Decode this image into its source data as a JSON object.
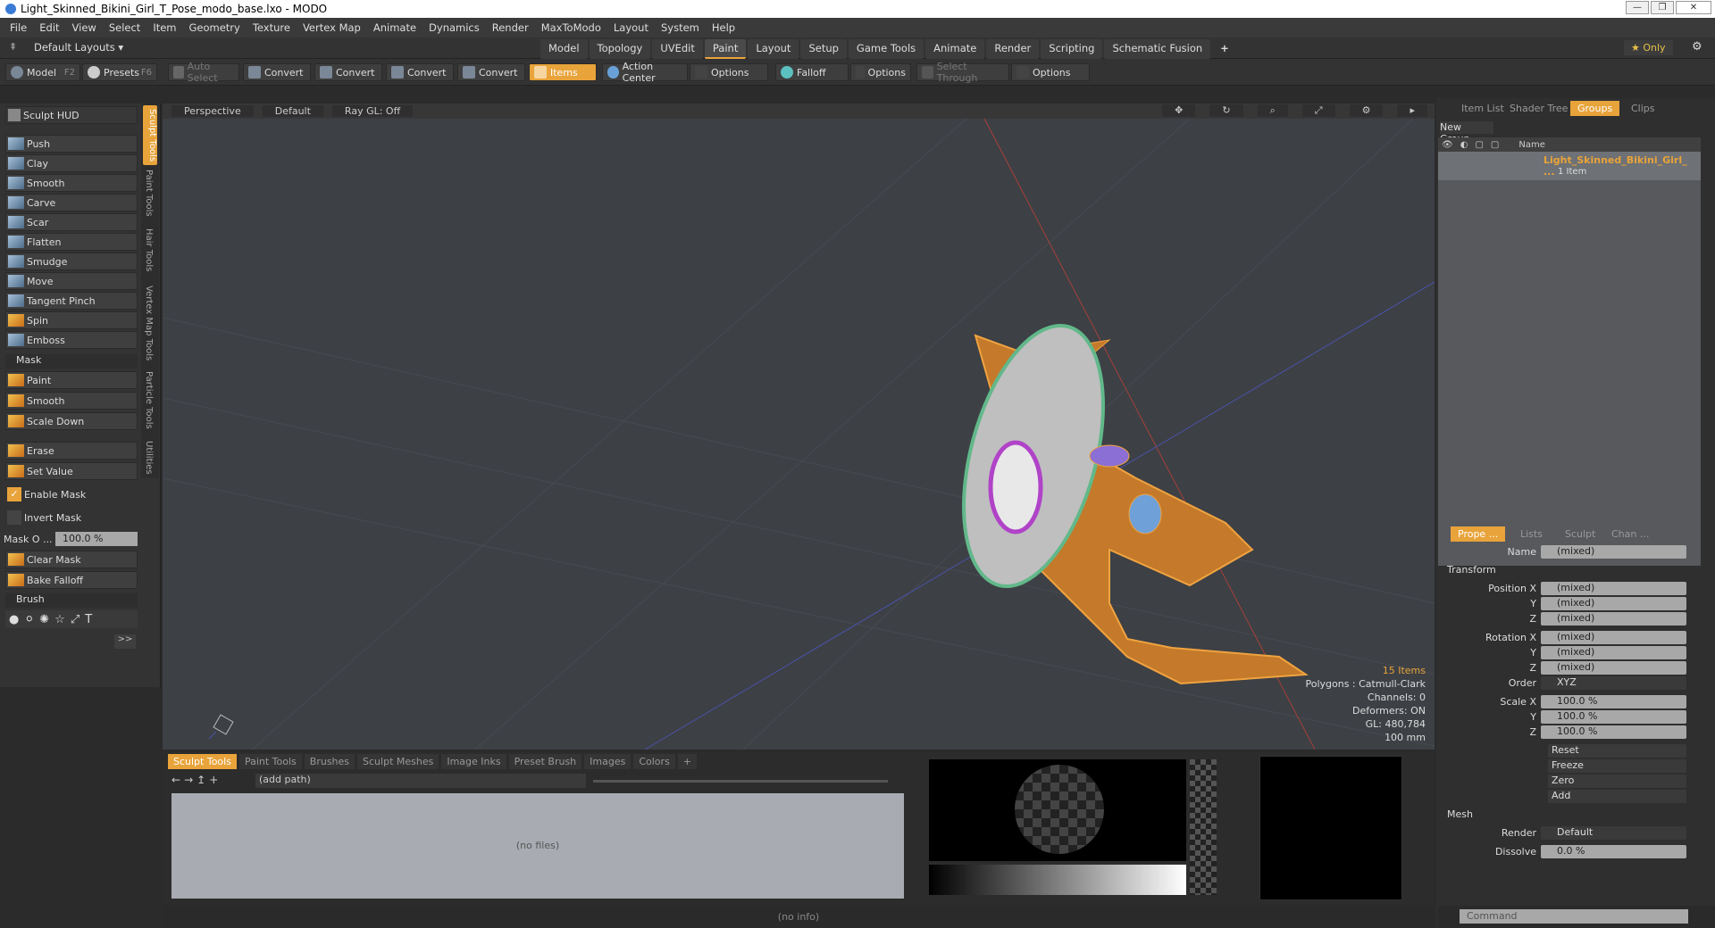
{
  "window": {
    "title": "Light_Skinned_Bikini_Girl_T_Pose_modo_base.lxo - MODO"
  },
  "menu": [
    "File",
    "Edit",
    "View",
    "Select",
    "Item",
    "Geometry",
    "Texture",
    "Vertex Map",
    "Animate",
    "Dynamics",
    "Render",
    "MaxToModo",
    "Layout",
    "System",
    "Help"
  ],
  "layout": {
    "name": "Default Layouts ▾",
    "only": "★ Only"
  },
  "tabs": [
    "Model",
    "Topology",
    "UVEdit",
    "Paint",
    "Layout",
    "Setup",
    "Game Tools",
    "Animate",
    "Render",
    "Scripting",
    "Schematic Fusion"
  ],
  "toolbar": {
    "model": "Model",
    "model_key": "F2",
    "presets": "Presets",
    "presets_key": "F6",
    "auto_select": "Auto Select",
    "convert": "Convert",
    "items": "Items",
    "action_center": "Action Center",
    "options": "Options",
    "falloff": "Falloff",
    "select_through": "Select Through"
  },
  "left": {
    "hud": "Sculpt HUD",
    "tools": [
      "Push",
      "Clay",
      "Smooth",
      "Carve",
      "Scar",
      "Flatten",
      "Smudge",
      "Move",
      "Tangent Pinch",
      "Spin",
      "Emboss"
    ],
    "mask_section": "Mask",
    "mask_tools": [
      "Paint",
      "Smooth",
      "Scale Down"
    ],
    "erase": "Erase",
    "set_value": "Set Value",
    "enable_mask": "Enable Mask",
    "invert_mask": "Invert Mask",
    "mask_opacity_label": "Mask O ...",
    "mask_opacity_value": "100.0 %",
    "clear_mask": "Clear Mask",
    "bake_falloff": "Bake Falloff",
    "brush_section": "Brush",
    "more": ">>"
  },
  "vtabs": [
    "Sculpt Tools",
    "Paint Tools",
    "Hair Tools",
    "Vertex Map Tools",
    "Particle Tools",
    "Utilities"
  ],
  "viewport": {
    "view": "Perspective",
    "shading": "Default",
    "raygl": "Ray GL: Off",
    "items": "15 Items",
    "polygons": "Polygons : Catmull-Clark",
    "channels": "Channels: 0",
    "deformers": "Deformers: ON",
    "gl": "GL: 480,784",
    "scale": "100 mm"
  },
  "bottom": {
    "tabs": [
      "Sculpt Tools",
      "Paint Tools",
      "Brushes",
      "Sculpt Meshes",
      "Image Inks",
      "Preset Brush",
      "Images",
      "Colors"
    ],
    "path": "(add path)",
    "nofiles": "(no files)",
    "status": "(no info)"
  },
  "right": {
    "tabs": [
      "Item List",
      "Shader Tree",
      "Groups",
      "Clips"
    ],
    "new_group": "New Group",
    "col_name": "Name",
    "group_name": "Light_Skinned_Bikini_Girl_ ...",
    "group_count": "1 Item",
    "ptabs": [
      "Prope ...",
      "Lists",
      "Sculpt",
      "Chan ..."
    ],
    "name_label": "Name",
    "name_value": "(mixed)",
    "transform": "Transform",
    "pos": [
      "Position X",
      "Y",
      "Z"
    ],
    "rot": [
      "Rotation X",
      "Y",
      "Z"
    ],
    "scale": [
      "Scale X",
      "Y",
      "Z"
    ],
    "mixed": "(mixed)",
    "order_label": "Order",
    "order_value": "XYZ",
    "pct": "100.0 %",
    "reset": "Reset",
    "freeze": "Freeze",
    "zero": "Zero",
    "add": "Add",
    "mesh": "Mesh",
    "render_label": "Render",
    "render_value": "Default",
    "dissolve_label": "Dissolve",
    "dissolve_value": "0.0 %",
    "command": "Command"
  }
}
